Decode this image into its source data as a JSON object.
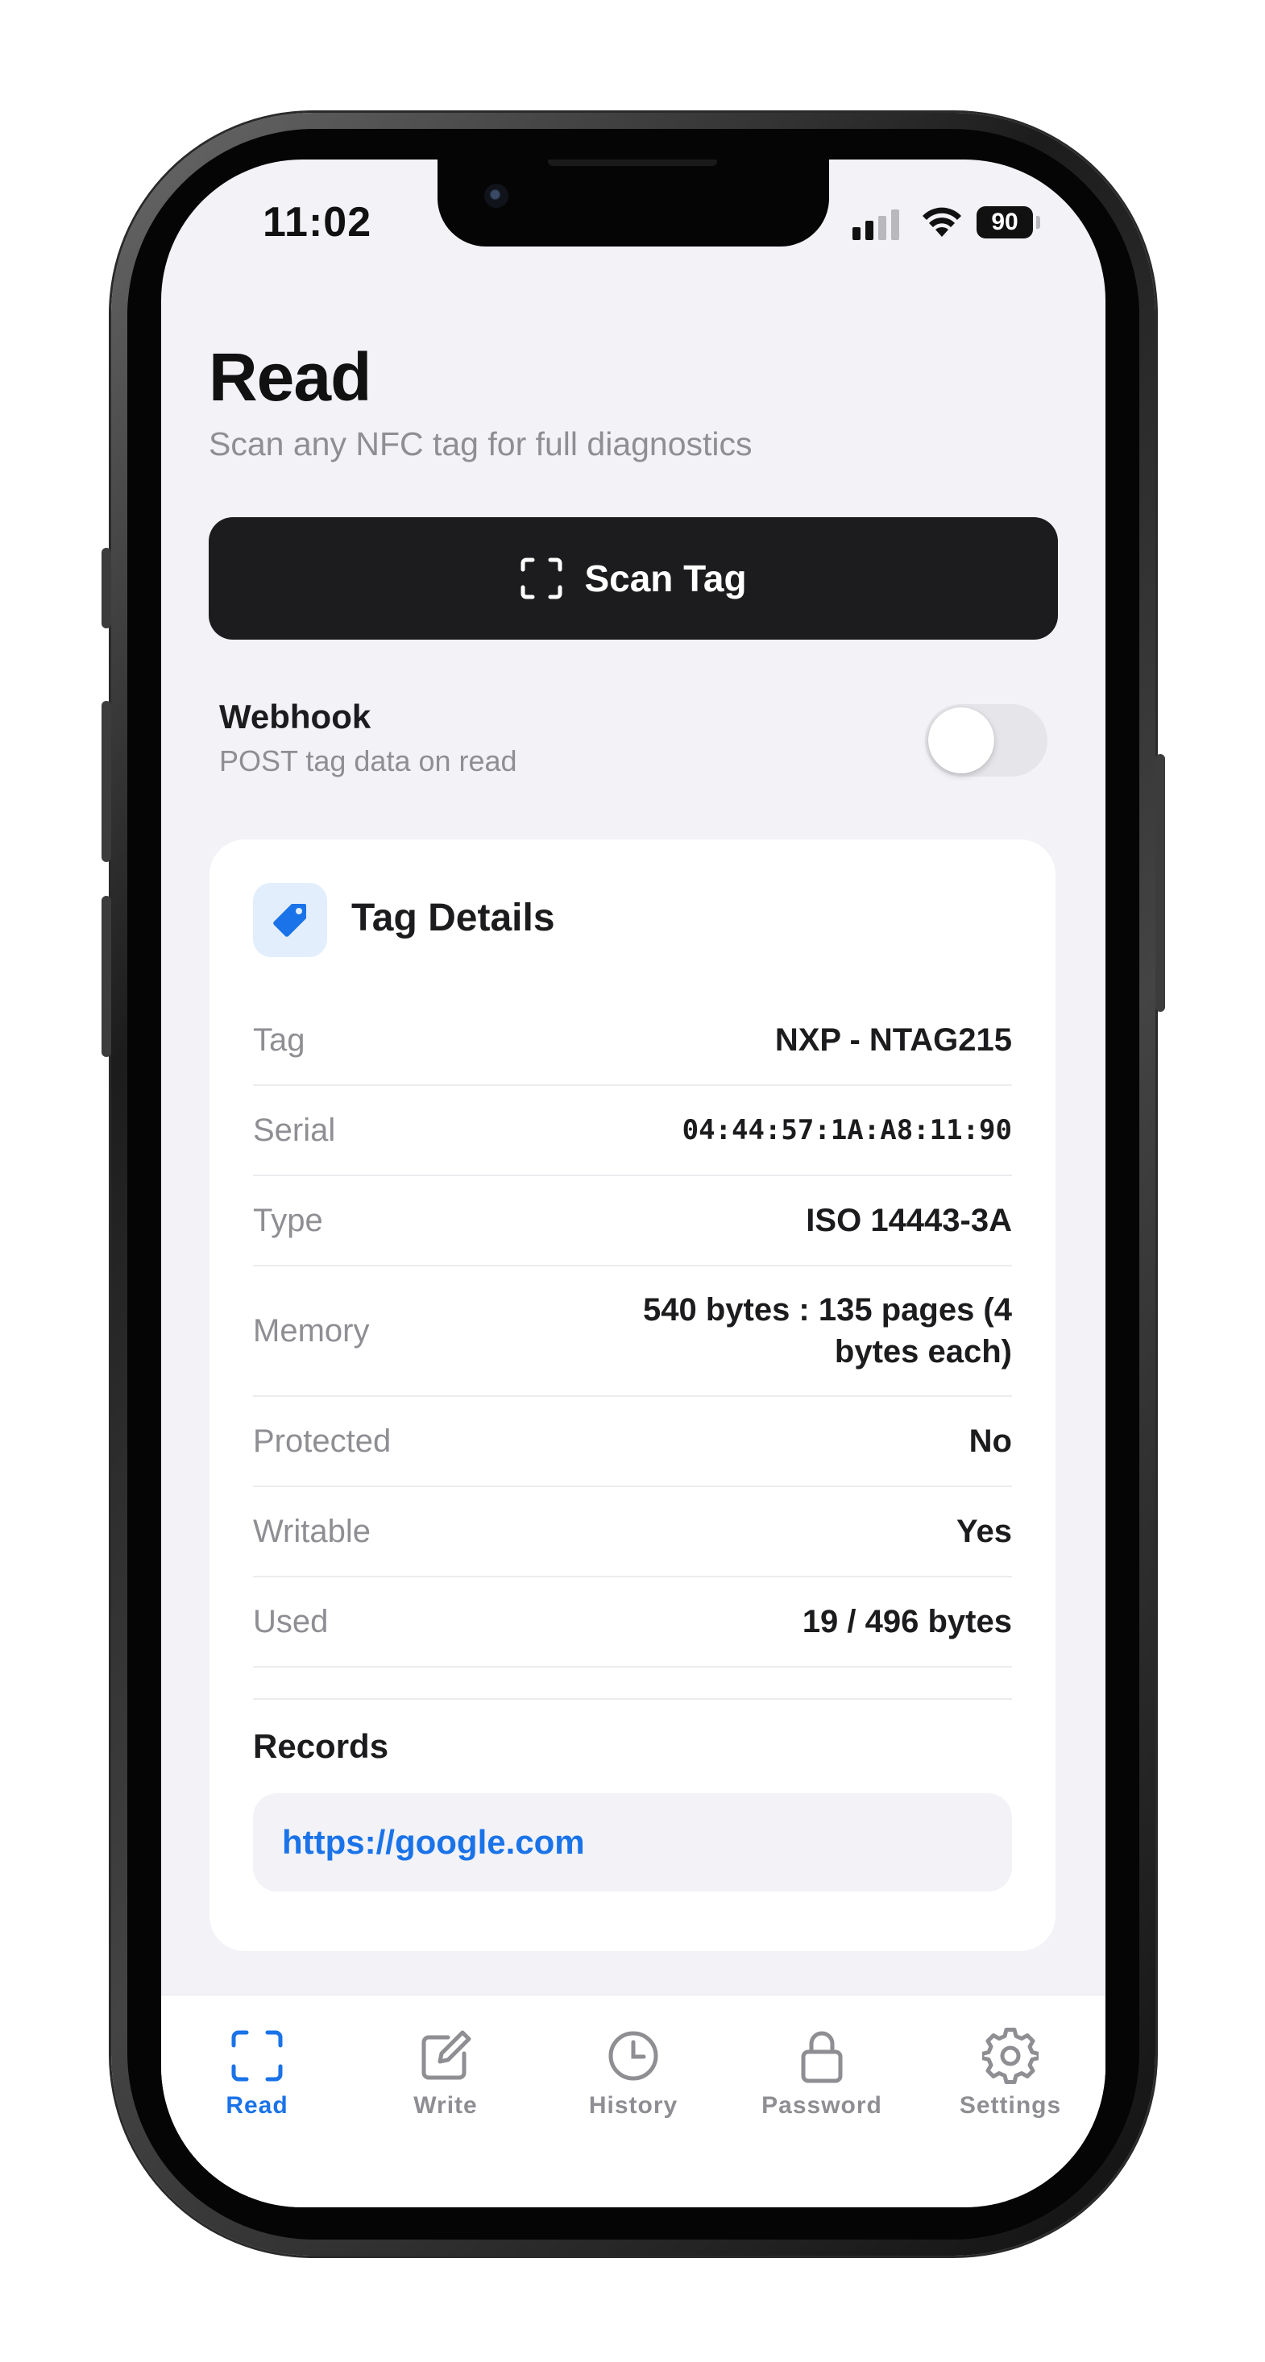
{
  "status_bar": {
    "time": "11:02",
    "battery": "90"
  },
  "header": {
    "title": "Read",
    "subtitle": "Scan any NFC tag for full diagnostics"
  },
  "scan_button": {
    "label": "Scan Tag",
    "icon": "scan-icon"
  },
  "webhook": {
    "title": "Webhook",
    "subtitle": "POST tag data on read",
    "enabled": false
  },
  "tag_details": {
    "title": "Tag Details",
    "icon": "tag-icon",
    "rows": [
      {
        "key": "Tag",
        "value": "NXP - NTAG215"
      },
      {
        "key": "Serial",
        "value": "04:44:57:1A:A8:11:90"
      },
      {
        "key": "Type",
        "value": "ISO 14443-3A"
      },
      {
        "key": "Memory",
        "value": "540 bytes : 135 pages (4 bytes each)"
      },
      {
        "key": "Protected",
        "value": "No"
      },
      {
        "key": "Writable",
        "value": "Yes"
      },
      {
        "key": "Used",
        "value": "19 / 496 bytes"
      }
    ],
    "records_title": "Records",
    "records": [
      "https://google.com"
    ]
  },
  "tabs": [
    {
      "label": "Read",
      "icon": "scan-icon",
      "active": true
    },
    {
      "label": "Write",
      "icon": "edit-icon",
      "active": false
    },
    {
      "label": "History",
      "icon": "clock-icon",
      "active": false
    },
    {
      "label": "Password",
      "icon": "lock-icon",
      "active": false
    },
    {
      "label": "Settings",
      "icon": "gear-icon",
      "active": false
    }
  ],
  "colors": {
    "accent": "#1a73e8",
    "background": "#f2f2f7",
    "button": "#1c1c1e",
    "muted": "#8e8e93"
  }
}
